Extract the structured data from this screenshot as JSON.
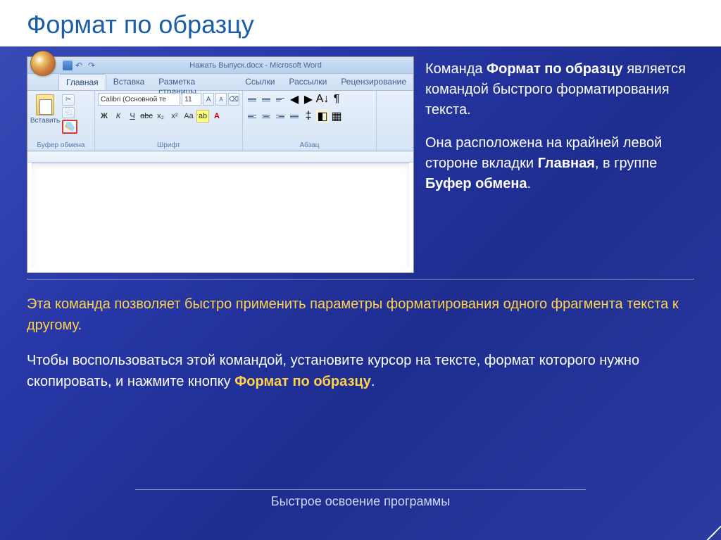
{
  "slide": {
    "title": "Формат по образцу",
    "footer": "Быстрое освоение программы"
  },
  "word": {
    "window_title": "Нажать Выпуск.docx - Microsoft Word",
    "tabs": [
      "Главная",
      "Вставка",
      "Разметка страницы",
      "Ссылки",
      "Рассылки",
      "Рецензирование"
    ],
    "active_tab": "Главная",
    "groups": {
      "clipboard": {
        "label": "Буфер обмена",
        "paste": "Вставить"
      },
      "font": {
        "label": "Шрифт",
        "name": "Calibri (Основной те",
        "size": "11"
      },
      "paragraph": {
        "label": "Абзац"
      }
    }
  },
  "text": {
    "r1_a": "Команда ",
    "r1_b": "Формат по образцу",
    "r1_c": " является командой быстрого форматирования текста.",
    "r2_a": "Она расположена на крайней левой стороне вкладки ",
    "r2_b": "Главная",
    "r2_c": ", в группе ",
    "r2_d": "Буфер обмена",
    "r2_e": ".",
    "l1": "Эта команда позволяет быстро применить параметры форматирования одного фрагмента текста к другому.",
    "l2_a": "Чтобы воспользоваться этой командой, установите курсор на тексте, формат которого нужно скопировать, и нажмите кнопку ",
    "l2_b": "Формат по образцу",
    "l2_c": "."
  }
}
